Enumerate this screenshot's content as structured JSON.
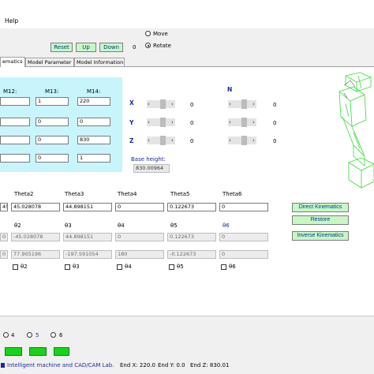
{
  "menu": {
    "help": "Help"
  },
  "toolbar": {
    "reset": "Reset",
    "up": "Up",
    "down": "Down",
    "counter": "0",
    "move": "Move",
    "rotate": "Rotate"
  },
  "tabs": [
    {
      "label": "ematics"
    },
    {
      "label": "Model Parameter"
    },
    {
      "label": "Model Information"
    }
  ],
  "m_panel": {
    "m12": "M12:",
    "m13": "M13:",
    "m14": "M14:",
    "rows": [
      {
        "c2": "1",
        "c3": "220"
      },
      {
        "c2": "0",
        "c3": "0"
      },
      {
        "c2": "0",
        "c3": "830"
      },
      {
        "c2": "0",
        "c3": "1"
      }
    ]
  },
  "sliders_left": [
    {
      "axis": "X",
      "value": "0"
    },
    {
      "axis": "Y",
      "value": "0"
    },
    {
      "axis": "Z",
      "value": "0"
    }
  ],
  "sliders_right": {
    "axis": "N",
    "values": [
      "0",
      "0",
      "0"
    ]
  },
  "base_height": {
    "label": "Base height:",
    "value": "830.00964"
  },
  "theta_headers": [
    "Theta2",
    "Theta3",
    "Theta4",
    "Theta5",
    "Theta6"
  ],
  "theta_values": [
    "45.028078",
    "44.898151",
    "0",
    "0.122673",
    "0"
  ],
  "theta_values_first_partial": "45",
  "greek_headers": [
    "θ2",
    "θ3",
    "θ4",
    "θ5",
    "θ6"
  ],
  "greek_row1": [
    "-45.028078",
    "44.898151",
    "0",
    "0.122673",
    "0"
  ],
  "greek_row1_partial": "0",
  "greek_row2": [
    "77.905196",
    "-197.591054",
    "180",
    "-0.122673",
    "0"
  ],
  "greek_row2_partial": "0",
  "checkboxes": [
    "θ2",
    "θ3",
    "θ4",
    "θ5",
    "θ6"
  ],
  "buttons": {
    "direct": "Direct Kinematics",
    "restore": "Restore",
    "inverse": "Inverse Kinematics"
  },
  "radio_bottom": [
    "4",
    "5",
    "6"
  ],
  "status": {
    "lab": "Intelligent machine and CAD/CAM Lab.",
    "end_x": "End X: 220.0",
    "end_y": "End Y: 0.0",
    "end_z": "End Z: 830.01"
  },
  "colors": {
    "accent_green": "#18d418",
    "panel_cyan": "#c8f4fb",
    "wire_green": "#33dd33"
  }
}
